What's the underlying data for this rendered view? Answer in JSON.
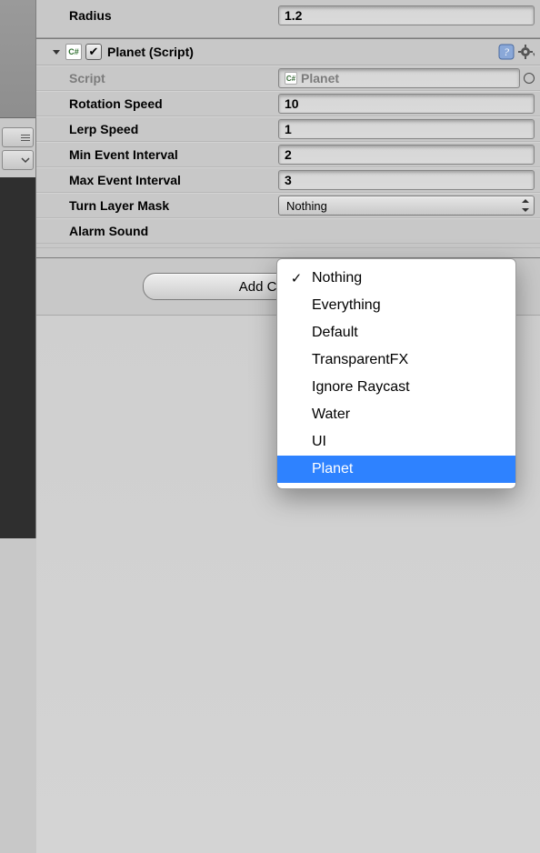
{
  "radius": {
    "label": "Radius",
    "value": "1.2"
  },
  "component": {
    "title": "Planet (Script)",
    "script_label": "Script",
    "script_name": "Planet",
    "props": {
      "rotation_speed": {
        "label": "Rotation Speed",
        "value": "10"
      },
      "lerp_speed": {
        "label": "Lerp Speed",
        "value": "1"
      },
      "min_event_interval": {
        "label": "Min Event Interval",
        "value": "2"
      },
      "max_event_interval": {
        "label": "Max Event Interval",
        "value": "3"
      },
      "turn_layer_mask": {
        "label": "Turn Layer Mask",
        "value": "Nothing"
      },
      "alarm_sound": {
        "label": "Alarm Sound"
      }
    }
  },
  "add_component": {
    "label": "Add Component"
  },
  "popup": {
    "items": [
      {
        "label": "Nothing",
        "checked": true
      },
      {
        "label": "Everything",
        "checked": false
      },
      {
        "label": "Default",
        "checked": false
      },
      {
        "label": "TransparentFX",
        "checked": false
      },
      {
        "label": "Ignore Raycast",
        "checked": false
      },
      {
        "label": "Water",
        "checked": false
      },
      {
        "label": "UI",
        "checked": false
      },
      {
        "label": "Planet",
        "checked": false
      }
    ],
    "highlight_index": 7
  },
  "icons": {
    "cs": "C#"
  }
}
